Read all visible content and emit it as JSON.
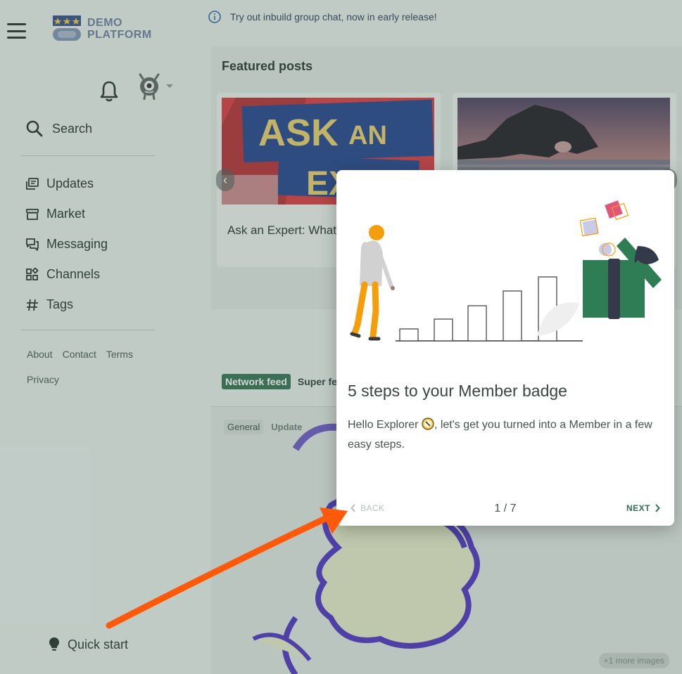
{
  "brand": {
    "line1": "DEMO",
    "line2": "PLATFORM"
  },
  "banner": {
    "text": "Try out inbuild group chat, now in early release!"
  },
  "sidebar": {
    "search_label": "Search",
    "items": [
      {
        "label": "Updates",
        "icon": "updates-icon"
      },
      {
        "label": "Market",
        "icon": "market-icon"
      },
      {
        "label": "Messaging",
        "icon": "messaging-icon"
      },
      {
        "label": "Channels",
        "icon": "channels-icon"
      },
      {
        "label": "Tags",
        "icon": "hash-icon"
      }
    ],
    "footer_links": [
      "About",
      "Contact",
      "Terms",
      "Privacy"
    ],
    "quick_start": "Quick start"
  },
  "featured": {
    "title": "Featured posts",
    "posts": [
      {
        "title": "Ask an Expert: What",
        "image_text_1": "ASK",
        "image_text_2": "AN",
        "image_text_3": "EXPERT"
      },
      {
        "title": ""
      }
    ]
  },
  "feed": {
    "tabs": [
      "Network feed",
      "Super fee"
    ],
    "post_tags": [
      "General",
      "Update"
    ],
    "more_images": "+1 more images"
  },
  "modal": {
    "title": "5 steps to your Member badge",
    "body_before": "Hello Explorer",
    "body_after": ", let's get you turned into a Member in a few easy steps.",
    "back": "BACK",
    "next": "NEXT",
    "pager": "1 / 7"
  },
  "colors": {
    "accent": "#2f6e50",
    "annotation_arrow": "#ff5a0a"
  }
}
